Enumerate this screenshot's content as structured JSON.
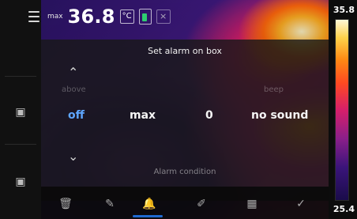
{
  "header": {
    "max_label": "max",
    "max_value": "36.8",
    "unit_icon": "degree-celsius-icon"
  },
  "scale": {
    "top_value": "35.8",
    "bottom_value": "25.4"
  },
  "panel": {
    "title": "Set alarm on box",
    "faint_labels": {
      "left": "above",
      "right": "beep"
    },
    "values": {
      "mode": "off",
      "target": "max",
      "threshold": "0",
      "sound": "no sound"
    },
    "condition_label": "Alarm condition"
  },
  "toolbar": {
    "items": [
      {
        "name": "trash-icon"
      },
      {
        "name": "edit-icon"
      },
      {
        "name": "bell-icon",
        "active": true
      },
      {
        "name": "pen-icon"
      },
      {
        "name": "grid-icon"
      },
      {
        "name": "confirm-icon"
      }
    ]
  }
}
